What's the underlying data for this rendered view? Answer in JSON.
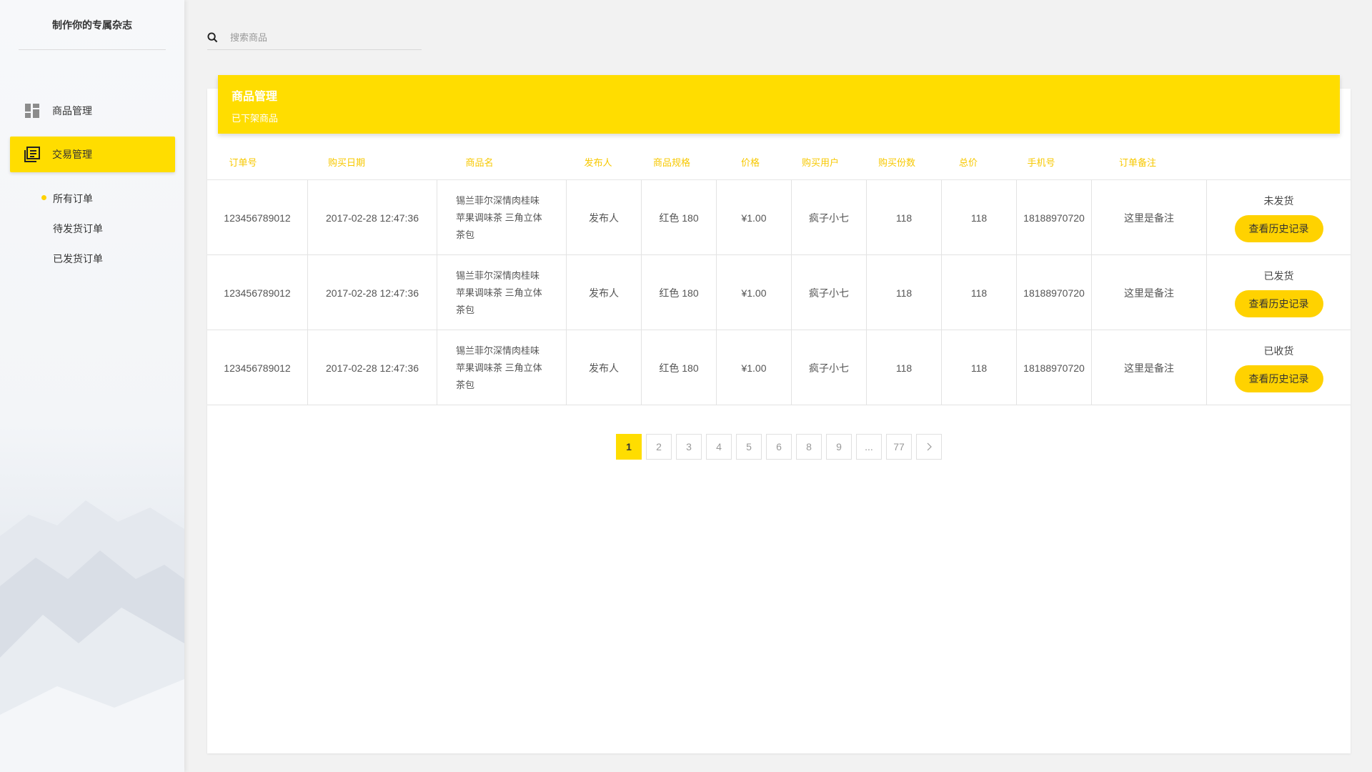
{
  "app": {
    "brand": "制作你的专属杂志"
  },
  "sidebar": {
    "items": [
      {
        "label": "商品管理",
        "icon": "dashboard-icon"
      },
      {
        "label": "交易管理",
        "icon": "orders-icon"
      }
    ],
    "sub_items": [
      {
        "label": "所有订单",
        "active": true
      },
      {
        "label": "待发货订单"
      },
      {
        "label": "已发货订单"
      }
    ]
  },
  "search": {
    "placeholder": "搜索商品",
    "icon": "search-icon"
  },
  "panel": {
    "title": "商品管理",
    "subtitle": "已下架商品"
  },
  "table": {
    "headers": [
      "订单号",
      "购买日期",
      "商品名",
      "发布人",
      "商品规格",
      "价格",
      "购买用户",
      "购买份数",
      "总价",
      "手机号",
      "订单备注"
    ],
    "rows": [
      {
        "order_no": "123456789012",
        "date": "2017-02-28 12:47:36",
        "name_lines": [
          "锡兰菲尔深情肉桂味",
          "苹果调味茶 三角立体",
          "茶包"
        ],
        "publisher": "发布人",
        "spec": "红色 180",
        "price": "¥1.00",
        "buyer": "疯子小七",
        "qty": "118",
        "total": "118",
        "phone": "18188970720",
        "note": "这里是备注",
        "status": "未发货",
        "action": "查看历史记录"
      },
      {
        "order_no": "123456789012",
        "date": "2017-02-28 12:47:36",
        "name_lines": [
          "锡兰菲尔深情肉桂味",
          "苹果调味茶 三角立体",
          "茶包"
        ],
        "publisher": "发布人",
        "spec": "红色 180",
        "price": "¥1.00",
        "buyer": "疯子小七",
        "qty": "118",
        "total": "118",
        "phone": "18188970720",
        "note": "这里是备注",
        "status": "已发货",
        "action": "查看历史记录"
      },
      {
        "order_no": "123456789012",
        "date": "2017-02-28 12:47:36",
        "name_lines": [
          "锡兰菲尔深情肉桂味",
          "苹果调味茶 三角立体",
          "茶包"
        ],
        "publisher": "发布人",
        "spec": "红色 180",
        "price": "¥1.00",
        "buyer": "疯子小七",
        "qty": "118",
        "total": "118",
        "phone": "18188970720",
        "note": "这里是备注",
        "status": "已收货",
        "action": "查看历史记录"
      }
    ]
  },
  "pagination": {
    "pages": [
      "1",
      "2",
      "3",
      "4",
      "5",
      "6",
      "8",
      "9",
      "...",
      "77"
    ],
    "current": "1",
    "next_icon": "chevron-right-icon"
  },
  "colors": {
    "accent": "#ffdd00",
    "header_text": "#f7c800"
  }
}
